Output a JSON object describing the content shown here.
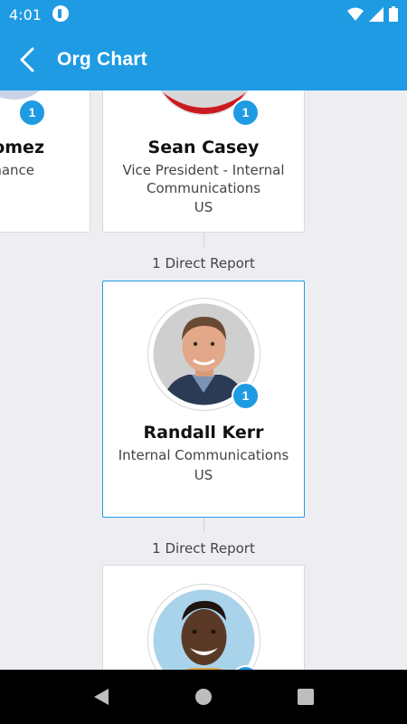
{
  "status_bar": {
    "time": "4:01"
  },
  "app_bar": {
    "title": "Org Chart"
  },
  "cards": {
    "partial_left": {
      "name": "omez",
      "role": "nance",
      "badge": "1"
    },
    "sean": {
      "name": "Sean Casey",
      "role": "Vice President - Internal Communications",
      "location": "US",
      "badge": "1"
    },
    "randall": {
      "name": "Randall Kerr",
      "role": "Internal Communications",
      "location": "US",
      "badge": "1"
    }
  },
  "report_labels": [
    "1 Direct Report",
    "1 Direct Report"
  ],
  "colors": {
    "accent": "#1f9be4",
    "background": "#eeeef2",
    "card": "#ffffff"
  }
}
